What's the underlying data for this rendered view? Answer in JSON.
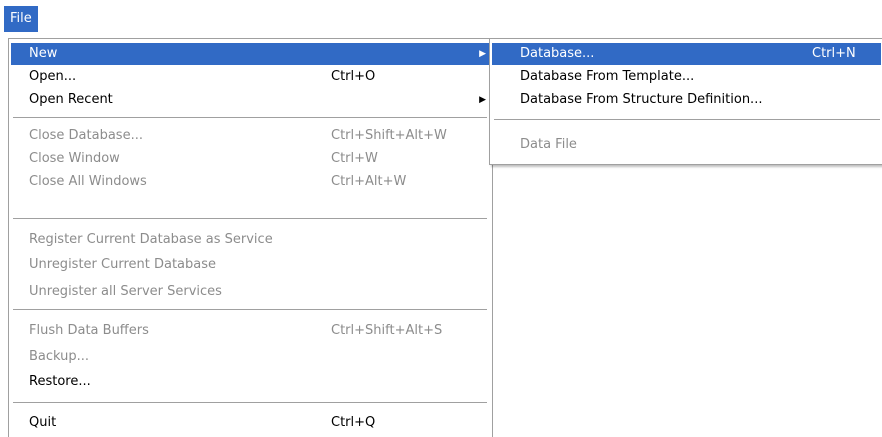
{
  "menubar": {
    "file_label": "File"
  },
  "file_menu": {
    "new": {
      "label": "New"
    },
    "open": {
      "label": "Open...",
      "shortcut": "Ctrl+O"
    },
    "open_recent": {
      "label": "Open Recent"
    },
    "close_database": {
      "label": "Close Database...",
      "shortcut": "Ctrl+Shift+Alt+W"
    },
    "close_window": {
      "label": "Close Window",
      "shortcut": "Ctrl+W"
    },
    "close_all_windows": {
      "label": "Close All Windows",
      "shortcut": "Ctrl+Alt+W"
    },
    "register_service": {
      "label": "Register Current Database as Service"
    },
    "unregister_current": {
      "label": "Unregister Current Database"
    },
    "unregister_all": {
      "label": "Unregister all Server Services"
    },
    "flush_buffers": {
      "label": "Flush Data Buffers",
      "shortcut": "Ctrl+Shift+Alt+S"
    },
    "backup": {
      "label": "Backup..."
    },
    "restore": {
      "label": "Restore..."
    },
    "quit": {
      "label": "Quit",
      "shortcut": "Ctrl+Q"
    }
  },
  "new_submenu": {
    "database": {
      "label": "Database...",
      "shortcut": "Ctrl+N"
    },
    "from_template": {
      "label": "Database From Template..."
    },
    "from_structure": {
      "label": "Database From Structure Definition..."
    },
    "data_file": {
      "label": "Data File"
    }
  },
  "colors": {
    "selection": "#316AC5",
    "disabled_text": "#8C8C8C",
    "separator": "#A0A0A0"
  },
  "icons": {
    "submenu_arrow": "triangle-right-icon"
  }
}
